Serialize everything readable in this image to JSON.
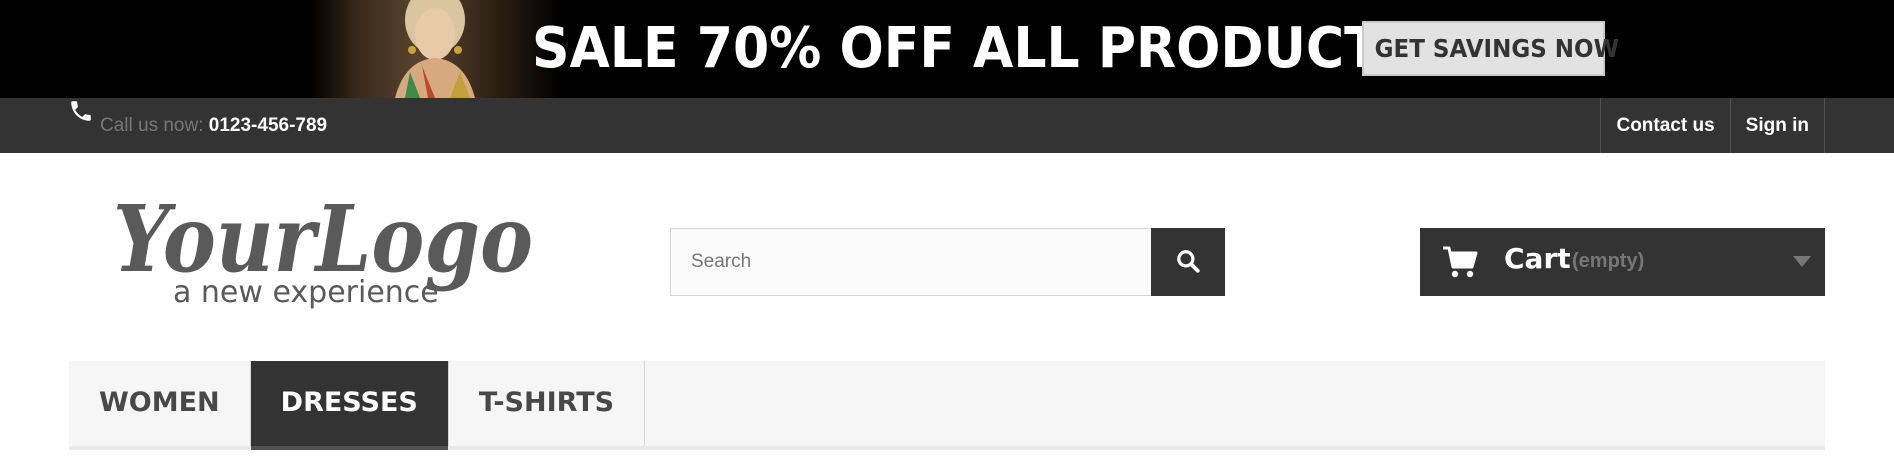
{
  "banner": {
    "headline": "SALE 70% OFF ALL PRODUCTS",
    "cta_label": "GET SAVINGS NOW"
  },
  "topbar": {
    "icon": "phone-icon",
    "call_prefix": "Call us now:",
    "phone_number": "0123-456-789",
    "links": {
      "contact": "Contact us",
      "signin": "Sign in"
    }
  },
  "logo": {
    "wordmark": "YourLogo",
    "tagline": "a new experience"
  },
  "search": {
    "placeholder": "Search",
    "icon": "search-icon"
  },
  "cart": {
    "icon": "shopping-cart-icon",
    "label": "Cart",
    "status": "(empty)"
  },
  "menu": {
    "items": [
      {
        "label": "WOMEN",
        "active": false
      },
      {
        "label": "DRESSES",
        "active": true
      },
      {
        "label": "T-SHIRTS",
        "active": false
      }
    ]
  },
  "colors": {
    "dark": "#333333",
    "menu_bg": "#f6f6f6",
    "muted_text": "#777777"
  }
}
